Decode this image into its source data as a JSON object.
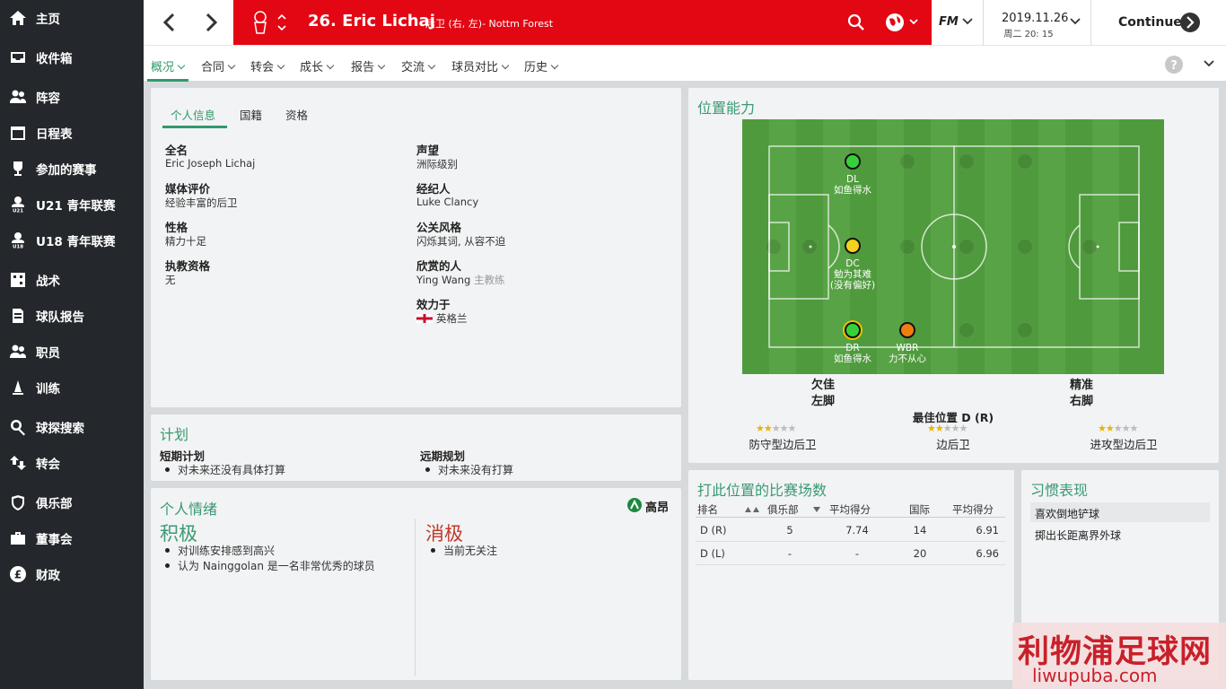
{
  "sidebar": {
    "items": [
      {
        "label": "主页",
        "icon": "home-icon"
      },
      {
        "label": "收件箱",
        "icon": "inbox-icon"
      },
      {
        "label": "阵容",
        "icon": "squad-icon"
      },
      {
        "label": "日程表",
        "icon": "calendar-icon"
      },
      {
        "label": "参加的赛事",
        "icon": "trophy-icon"
      },
      {
        "label": "U21 青年联赛",
        "icon": "u21-icon"
      },
      {
        "label": "U18 青年联赛",
        "icon": "u18-icon"
      },
      {
        "label": "战术",
        "icon": "tactics-icon"
      },
      {
        "label": "球队报告",
        "icon": "report-icon"
      },
      {
        "label": "职员",
        "icon": "staff-icon"
      },
      {
        "label": "训练",
        "icon": "training-icon"
      },
      {
        "label": "球探搜索",
        "icon": "search-icon"
      },
      {
        "label": "转会",
        "icon": "transfer-icon"
      },
      {
        "label": "俱乐部",
        "icon": "club-icon"
      },
      {
        "label": "董事会",
        "icon": "board-icon"
      },
      {
        "label": "财政",
        "icon": "finance-icon"
      }
    ]
  },
  "header": {
    "player_title": "26. Eric Lichaj",
    "player_sub": "后卫 (右, 左)- Nottm Forest",
    "fm_label": "FM",
    "date": "2019.11.26",
    "weekday": "周二 20: 15",
    "continue_label": "Continue",
    "accent": "#e30613"
  },
  "subnav": {
    "tabs": [
      "概况",
      "合同",
      "转会",
      "成长",
      "报告",
      "交流",
      "球员对比",
      "历史"
    ]
  },
  "info": {
    "tabs": [
      "个人信息",
      "国籍",
      "资格"
    ],
    "fullname_label": "全名",
    "fullname": "Eric Joseph Lichaj",
    "media_label": "媒体评价",
    "media": "经验丰富的后卫",
    "personality_label": "性格",
    "personality": "精力十足",
    "coaching_label": "执教资格",
    "coaching": "无",
    "reputation_label": "声望",
    "reputation": "洲际级别",
    "agent_label": "经纪人",
    "agent": "Luke Clancy",
    "media_style_label": "公关风格",
    "media_style": "闪烁其词, 从容不迫",
    "favourite_label": "欣赏的人",
    "favourite_name": "Ying Wang",
    "favourite_role": "主教练",
    "plays_for_label": "效力于",
    "plays_for": "英格兰"
  },
  "plans": {
    "title": "计划",
    "short_label": "短期计划",
    "short_item": "对未来还没有具体打算",
    "long_label": "远期规划",
    "long_item": "对未来没有打算"
  },
  "mood": {
    "title": "个人情绪",
    "level": "高昂",
    "positive_label": "积极",
    "positive_items": [
      "对训练安排感到高兴",
      "认为 Nainggolan 是一名非常优秀的球员"
    ],
    "negative_label": "消极",
    "negative_items": [
      "当前无关注"
    ]
  },
  "positions": {
    "title": "位置能力",
    "dl_code": "DL",
    "dl_rating": "如鱼得水",
    "dc_code": "DC",
    "dc_rating": "勉为其难",
    "dc_rating2": "(没有偏好)",
    "dr_code": "DR",
    "dr_rating": "如鱼得水",
    "wbr_code": "WBR",
    "wbr_rating": "力不从心",
    "left_foot_quality": "欠佳",
    "left_foot_label": "左脚",
    "right_foot_quality": "精准",
    "right_foot_label": "右脚",
    "best_label": "最佳位置 D (R)",
    "roles": [
      {
        "name": "防守型边后卫",
        "stars": 1.5
      },
      {
        "name": "边后卫",
        "stars": 1.5
      },
      {
        "name": "进攻型边后卫",
        "stars": 1.5
      }
    ],
    "colors": {
      "natural": "#36d13a",
      "awkward": "#f2d21b",
      "unconvincing": "#f07d12"
    }
  },
  "appearances": {
    "title": "打此位置的比赛场数",
    "headers": [
      "排名",
      "俱乐部",
      "平均得分",
      "国际",
      "平均得分"
    ],
    "rows": [
      {
        "pos": "D (R)",
        "club": "5",
        "club_avg": "7.74",
        "intl": "14",
        "intl_avg": "6.91"
      },
      {
        "pos": "D (L)",
        "club": "-",
        "club_avg": "-",
        "intl": "20",
        "intl_avg": "6.96"
      }
    ]
  },
  "traits": {
    "title": "习惯表现",
    "items": [
      "喜欢倒地铲球",
      "掷出长距离界外球"
    ]
  },
  "watermark": {
    "text": "利物浦足球网",
    "url": "liwupuba.com"
  }
}
